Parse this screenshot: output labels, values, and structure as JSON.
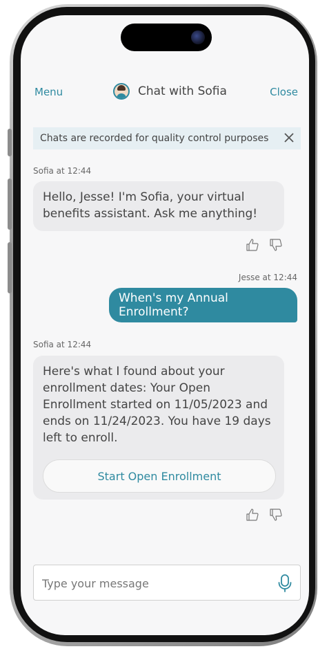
{
  "header": {
    "menu_label": "Menu",
    "title": "Chat with Sofia",
    "close_label": "Close"
  },
  "notice": {
    "text": "Chats are recorded for quality control purposes"
  },
  "messages": [
    {
      "meta": "Sofia at 12:44",
      "text": "Hello, Jesse! I'm Sofia, your virtual benefits assistant. Ask me anything!"
    },
    {
      "meta": "Jesse at 12:44",
      "text": "When's my Annual Enrollment?"
    },
    {
      "meta": "Sofia at 12:44",
      "text": "Here's what I found about your enrollment dates: Your Open Enrollment started on 11/05/2023 and ends on 11/24/2023. You have 19 days left to enroll.",
      "action_label": "Start Open Enrollment"
    }
  ],
  "composer": {
    "placeholder": "Type your message"
  },
  "colors": {
    "accent": "#2f8aa0",
    "bubble_bg": "#ebebed",
    "notice_bg": "#e6eff3"
  },
  "icons": [
    "avatar-icon",
    "close-icon",
    "thumbs-up-icon",
    "thumbs-down-icon",
    "microphone-icon"
  ]
}
